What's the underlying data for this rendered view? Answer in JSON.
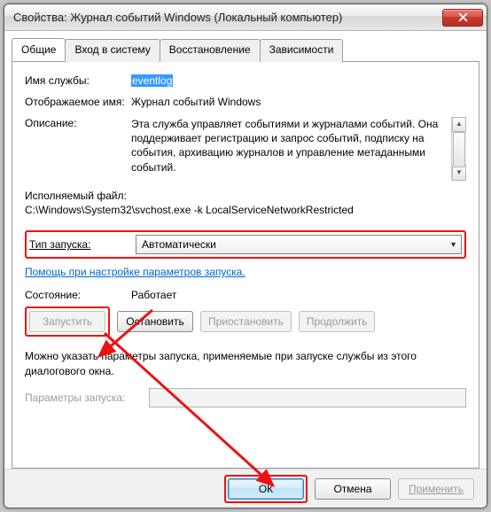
{
  "window": {
    "title": "Свойства: Журнал событий Windows (Локальный компьютер)"
  },
  "tabs": {
    "general": "Общие",
    "logon": "Вход в систему",
    "recovery": "Восстановление",
    "dependencies": "Зависимости"
  },
  "labels": {
    "service_name": "Имя службы:",
    "display_name": "Отображаемое имя:",
    "description": "Описание:",
    "executable": "Исполняемый файл:",
    "startup_type": "Тип запуска:",
    "help_link": "Помощь при настройке параметров запуска.",
    "status": "Состояние:",
    "note": "Можно указать параметры запуска, применяемые при запуске службы из этого диалогового окна.",
    "start_params": "Параметры запуска:"
  },
  "values": {
    "service_name": "eventlog",
    "display_name": "Журнал событий Windows",
    "description": "Эта служба управляет событиями и журналами событий. Она поддерживает регистрацию и запрос событий, подписку на события, архивацию журналов и управление метаданными событий.",
    "executable_path": "C:\\Windows\\System32\\svchost.exe -k LocalServiceNetworkRestricted",
    "startup_type": "Автоматически",
    "status": "Работает",
    "start_params": ""
  },
  "buttons": {
    "start": "Запустить",
    "stop": "Остановить",
    "pause": "Приостановить",
    "resume": "Продолжить",
    "ok": "ОК",
    "cancel": "Отмена",
    "apply": "Применить"
  }
}
